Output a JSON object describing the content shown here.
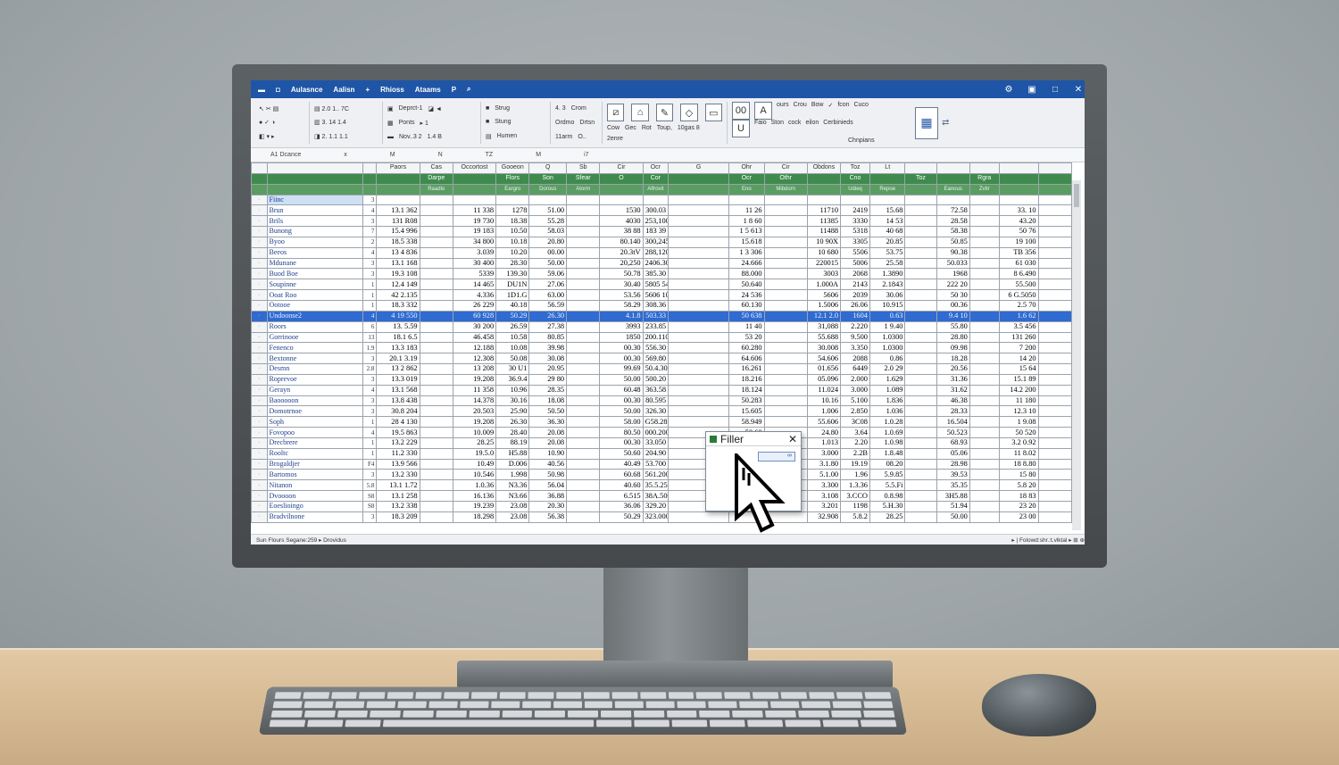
{
  "window": {
    "title_items": [
      "Aulasnce",
      "Aalisn",
      "+",
      "Rhioss",
      "Ataams",
      "P"
    ],
    "controls": [
      "⚙",
      "▣",
      "□",
      "✕"
    ]
  },
  "ribbon": {
    "group1": [
      "Deprct-1",
      "Ponts",
      "Nov..3 2"
    ],
    "group2": [
      "Strug",
      "Stung",
      "Humen"
    ],
    "group3": [
      "4. 3",
      "Crom",
      "Ordmo",
      "Drtsn",
      "11arm"
    ],
    "group4": [
      "Cow",
      "Gec",
      "Rot",
      "Toup,",
      "10gas 8",
      "2enre"
    ],
    "group5": [
      "00",
      "A",
      "U",
      "ours",
      "Faio",
      "Crou",
      "Bow",
      "Ston",
      "cock",
      "fcon",
      "eilon",
      "Cuco",
      "Cerbinieds",
      "Chnpians"
    ]
  },
  "namebox": {
    "cell": "A1 Dcance",
    "col_letters": [
      "x",
      "M",
      "N",
      "TZ",
      "M",
      "i7"
    ]
  },
  "sheet": {
    "col_heads": [
      "Paors",
      "Cas",
      "Occortost",
      "Gooeon",
      "Q",
      "Sb",
      "Cir",
      "Ocr",
      "G",
      "Ohr",
      "Cir",
      "Obdons",
      "Toz",
      "Lt"
    ],
    "header_row": [
      "Darpe",
      "",
      "Flors",
      "Son",
      "Sfear",
      "O",
      "Cor",
      "",
      "Ocr",
      "Othr",
      "",
      "Cno",
      "",
      "Toz",
      "",
      "Rgra"
    ],
    "sub_row": [
      "Raadio",
      "",
      "Eargro",
      "Dorous",
      "Atorm",
      "",
      "Alfrovit",
      "",
      "Eno",
      "Mibdorn",
      "",
      "Udieq",
      "Repoe",
      "",
      "Eanous",
      "Zvtir"
    ],
    "rows": [
      {
        "label": "Fiinc",
        "idx": "3",
        "cells": [
          "",
          "",
          "",
          "",
          "",
          "",
          "",
          "",
          "",
          "",
          "",
          "",
          "",
          "",
          "",
          ""
        ]
      },
      {
        "label": "Brun",
        "idx": "4",
        "cells": [
          "13.1 362",
          "",
          "11 338",
          "1278",
          "51.00",
          "",
          "1530",
          "300.03",
          "",
          "11 26",
          "",
          "11710",
          "2419",
          "15.68",
          "",
          "72.58",
          "",
          "33. 10"
        ]
      },
      {
        "label": "Brils",
        "idx": "3",
        "cells": [
          "131 R08",
          "",
          "19 730",
          "18.38",
          "55.28",
          "",
          "4030",
          "253,100",
          "",
          "1 8 60",
          "",
          "11385",
          "3330",
          "14 53",
          "",
          "28.58",
          "",
          "43.20"
        ]
      },
      {
        "label": "Bunong",
        "idx": "7",
        "cells": [
          "15.4 996",
          "",
          "19 183",
          "10.50",
          "58.03",
          "",
          "38 88",
          "183 39",
          "",
          "1 5 613",
          "",
          "11488",
          "5318",
          "40 68",
          "",
          "58.38",
          "",
          "50 76"
        ]
      },
      {
        "label": "Byoo",
        "idx": "2",
        "cells": [
          "18.5 338",
          "",
          "34 800",
          "10.18",
          "20.80",
          "",
          "80.140",
          "300,245",
          "",
          "15.618",
          "",
          "10 90X",
          "3305",
          "20.85",
          "",
          "50.85",
          "",
          "19 100"
        ]
      },
      {
        "label": "Beeos",
        "idx": "4",
        "cells": [
          "13 4 836",
          "",
          "3.039",
          "10.20",
          "00.00",
          "",
          "20.3tV",
          "288,120",
          "",
          "1 3 306",
          "",
          "10 680",
          "5506",
          "53.75",
          "",
          "90.38",
          "",
          "TB 356"
        ]
      },
      {
        "label": "Mdunane",
        "idx": "3",
        "cells": [
          "13.1 168",
          "",
          "30 400",
          "28.30",
          "50.00",
          "",
          "20,250",
          "2406.300",
          "",
          "24.666",
          "",
          "220015",
          "5006",
          "25.58",
          "",
          "50.033",
          "",
          "61 030"
        ]
      },
      {
        "label": "Buod Boe",
        "idx": "3",
        "cells": [
          "19.3 108",
          "",
          "5339",
          "139.30",
          "59.06",
          "",
          "50.78",
          "385.30",
          "",
          "88.000",
          "",
          "3003",
          "2068",
          "1.3890",
          "",
          "1968",
          "",
          "8 6.490"
        ]
      },
      {
        "label": "Soupinne",
        "idx": "1",
        "cells": [
          "12.4 149",
          "",
          "14 465",
          "DU1N",
          "27.06",
          "",
          "30.40",
          "5805 546",
          "",
          "50.640",
          "",
          "1.000A",
          "2143",
          "2.1843",
          "",
          "222 20",
          "",
          "55.500"
        ]
      },
      {
        "label": "Ooat Roo",
        "idx": "1",
        "cells": [
          "42 2.135",
          "",
          "4.336",
          "1D1.G",
          "63.00",
          "",
          "53.56",
          "5606 108",
          "",
          "24 536",
          "",
          "5606",
          "2039",
          "30.06",
          "",
          "50 30",
          "",
          "6 G.5050"
        ]
      },
      {
        "label": "Ootooe",
        "idx": "1",
        "cells": [
          "18.3 332",
          "",
          "26 229",
          "40.18",
          "56.59",
          "",
          "58.29",
          "308.36",
          "",
          "60.130",
          "",
          "1.5006",
          "26.06",
          "10.915",
          "",
          "00.36",
          "",
          "2.5 70"
        ]
      },
      {
        "label": "Undoonse2",
        "idx": "4",
        "sel": true,
        "cells": [
          "4 19 550",
          "",
          "60 928",
          "50.29",
          "26.30",
          "",
          "4.1.8",
          "503.33",
          "",
          "50 638",
          "",
          "12.1 2.0",
          "1604",
          "0.63",
          "",
          "9.4 10",
          "",
          "1.6 62"
        ]
      },
      {
        "label": "Roors",
        "idx": "6",
        "cells": [
          "13. 5.59",
          "",
          "30 200",
          "26.59",
          "27.38",
          "",
          "3993",
          "233.85",
          "",
          "11 40",
          "",
          "31,088",
          "2.220",
          "1 9.40",
          "",
          "55.80",
          "",
          "3.5 456"
        ]
      },
      {
        "label": "Gorrinooe",
        "idx": "13",
        "cells": [
          "18.1 6.5",
          "",
          "46.458",
          "10.58",
          "80.85",
          "",
          "1850",
          "200.110",
          "",
          "53 20",
          "",
          "55.688",
          "9.500",
          "1.0300",
          "",
          "28.80",
          "",
          "131 260"
        ]
      },
      {
        "label": "Fenenco",
        "idx": "1.9",
        "cells": [
          "13.3 183",
          "",
          "12.188",
          "10.08",
          "39.98",
          "",
          "00.30",
          "556.30",
          "",
          "60.280",
          "",
          "30.008",
          "3.350",
          "1.0300",
          "",
          "09.98",
          "",
          "7 200"
        ]
      },
      {
        "label": "Bextonne",
        "idx": "3",
        "cells": [
          "20.1 3.19",
          "",
          "12.308",
          "50.08",
          "30.08",
          "",
          "00.30",
          "569.80",
          "",
          "64.606",
          "",
          "54.606",
          "2088",
          "0.86",
          "",
          "18.28",
          "",
          "14 20"
        ]
      },
      {
        "label": "Desmn",
        "idx": "2.8",
        "cells": [
          "13 2 862",
          "",
          "13 208",
          "30 U1",
          "20.95",
          "",
          "99.69",
          "50.4.30",
          "",
          "16.261",
          "",
          "01.656",
          "6449",
          "2.0 29",
          "",
          "20.56",
          "",
          "15 64"
        ]
      },
      {
        "label": "Roprevoe",
        "idx": "3",
        "cells": [
          "13.3 019",
          "",
          "19.208",
          "36.9.4",
          "29 80",
          "",
          "50.00",
          "500.20",
          "",
          "18.216",
          "",
          "05.096",
          "2.000",
          "1.629",
          "",
          "31.36",
          "",
          "15.1 89"
        ]
      },
      {
        "label": "Gerayn",
        "idx": "4",
        "cells": [
          "13.1 568",
          "",
          "11 358",
          "10.96",
          "28.35",
          "",
          "60.48",
          "363.58",
          "",
          "18.124",
          "",
          "11.024",
          "3.000",
          "1.089",
          "",
          "31.62",
          "",
          "14.2 200"
        ]
      },
      {
        "label": "Baooooon",
        "idx": "3",
        "cells": [
          "13.8 438",
          "",
          "14.378",
          "30.16",
          "18.08",
          "",
          "00.30",
          "80.595",
          "",
          "50.283",
          "",
          "10.16",
          "5.100",
          "1.836",
          "",
          "46.38",
          "",
          "11 180"
        ]
      },
      {
        "label": "Domotrnoe",
        "idx": "3",
        "cells": [
          "30.8 204",
          "",
          "20.503",
          "25.90",
          "50.50",
          "",
          "50.00",
          "326.30",
          "",
          "15.605",
          "",
          "1.006",
          "2.850",
          "1.036",
          "",
          "28.33",
          "",
          "12.3 10"
        ]
      },
      {
        "label": "Soph",
        "idx": "1",
        "cells": [
          "28 4 130",
          "",
          "19.208",
          "26.30",
          "36.30",
          "",
          "58.00",
          "G58.28",
          "",
          "58.949",
          "",
          "55.606",
          "3C08",
          "1.0.28",
          "",
          "16.504",
          "",
          "1 9.08"
        ]
      },
      {
        "label": "Fovopoo",
        "idx": "4",
        "cells": [
          "19.5 863",
          "",
          "10.009",
          "28.40",
          "20.08",
          "",
          "80.50",
          "000.200",
          "",
          "50.60",
          "",
          "24.80",
          "3.64",
          "1.0.69",
          "",
          "50.523",
          "",
          "50 520"
        ]
      },
      {
        "label": "Drecbrere",
        "idx": "1",
        "cells": [
          "13.2 229",
          "",
          "28.25",
          "88.19",
          "20.08",
          "",
          "00.30",
          "33.050",
          "",
          "",
          "",
          "1.013",
          "2.20",
          "1.0.98",
          "",
          "68.93",
          "",
          "3.2 0.92"
        ]
      },
      {
        "label": "Rooltc",
        "idx": "1",
        "cells": [
          "11.2 330",
          "",
          "19.5.0",
          "H5.88",
          "10.90",
          "",
          "50.60",
          "204.90",
          "",
          "",
          "",
          "3.000",
          "2.2B",
          "1.8.48",
          "",
          "05.06",
          "",
          "11 8.02"
        ]
      },
      {
        "label": "Brogaldjer",
        "idx": "F4",
        "cells": [
          "13.9 566",
          "",
          "10.49",
          "D.006",
          "40.56",
          "",
          "40.49",
          "53.700",
          "",
          "",
          "",
          "3.1.80",
          "19.19",
          "08.20",
          "",
          "28.98",
          "",
          "18 8.80"
        ]
      },
      {
        "label": "Bartomos",
        "idx": "3",
        "cells": [
          "13.2 330",
          "",
          "10.546",
          "1.998",
          "50.98",
          "",
          "60.68",
          "561.200",
          "",
          "",
          "",
          "5.1.00",
          "1.96",
          "5.9.85",
          "",
          "39.53",
          "",
          "15 80"
        ]
      },
      {
        "label": "Nitanon",
        "idx": "5.8",
        "cells": [
          "13.1 1.72",
          "",
          "1.0.36",
          "N3.36",
          "56.04",
          "",
          "40.60",
          "35.5.25",
          "",
          "",
          "",
          "3.300",
          "1.3.36",
          "5.5.Fi",
          "",
          "35.35",
          "",
          "5.8 20"
        ]
      },
      {
        "label": "Dvoooon",
        "idx": "S8",
        "cells": [
          "13.1 258",
          "",
          "16.136",
          "N3.66",
          "36.88",
          "",
          "6.515",
          "38A.500",
          "",
          "",
          "",
          "3.108",
          "3.CCO",
          "0.8.98",
          "",
          "3H5.88",
          "",
          "18 83"
        ]
      },
      {
        "label": "Eoeslioingo",
        "idx": "S8",
        "cells": [
          "13.2 338",
          "",
          "19.239",
          "23.08",
          "20.30",
          "",
          "36.06",
          "329.20",
          "",
          "",
          "",
          "3.201",
          "1198",
          "5.H.30",
          "",
          "51.94",
          "",
          "23 20"
        ]
      },
      {
        "label": "Bradvilnone",
        "idx": "3",
        "cells": [
          "18.3 209",
          "",
          "18.298",
          "23.08",
          "56.38",
          "",
          "50.29",
          "323.000",
          "",
          "",
          "",
          "32.908",
          "5.8.2",
          "28.25",
          "",
          "50.00",
          "",
          "23 00"
        ]
      }
    ]
  },
  "popup": {
    "title": "Filler",
    "close": "✕",
    "value": "∞"
  },
  "status": {
    "left": "Sun  Flours  Segane:259  ▸  Drovidus",
    "right": "▸ | Folowd:shr.:t.vlktal  ▸  ⊞  ⊕"
  }
}
